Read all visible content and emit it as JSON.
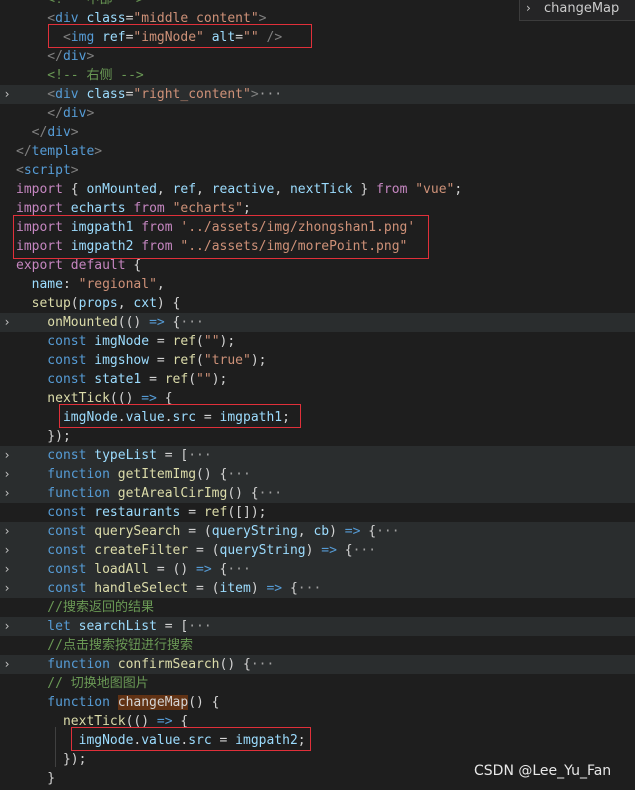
{
  "find_widget": {
    "query": "changeMap"
  },
  "lines": [
    {
      "fold": "",
      "segments": [
        [
          "t-cmt",
          "    <!-- 中部 -->"
        ]
      ]
    },
    {
      "fold": "",
      "segments": [
        [
          "t-tag",
          "    <"
        ],
        [
          "t-name",
          "div"
        ],
        [
          "t-pl",
          " "
        ],
        [
          "t-attr",
          "class"
        ],
        [
          "t-pl",
          "="
        ],
        [
          "t-str",
          "\"middle content\""
        ],
        [
          "t-tag",
          ">"
        ]
      ]
    },
    {
      "fold": "",
      "segments": [
        [
          "t-tag",
          "      <"
        ],
        [
          "t-name",
          "img"
        ],
        [
          "t-pl",
          " "
        ],
        [
          "t-attr",
          "ref"
        ],
        [
          "t-pl",
          "="
        ],
        [
          "t-str",
          "\"imgNode\""
        ],
        [
          "t-pl",
          " "
        ],
        [
          "t-attr",
          "alt"
        ],
        [
          "t-pl",
          "="
        ],
        [
          "t-str",
          "\"\""
        ],
        [
          "t-pl",
          " "
        ],
        [
          "t-tag",
          "/>"
        ]
      ]
    },
    {
      "fold": "",
      "segments": [
        [
          "t-tag",
          "    </"
        ],
        [
          "t-name",
          "div"
        ],
        [
          "t-tag",
          ">"
        ]
      ]
    },
    {
      "fold": "",
      "segments": [
        [
          "t-cmt",
          "    <!-- 右侧 -->"
        ]
      ]
    },
    {
      "fold": "›",
      "segments": [
        [
          "t-tag",
          "    <"
        ],
        [
          "t-name",
          "div"
        ],
        [
          "t-pl",
          " "
        ],
        [
          "t-attr",
          "class"
        ],
        [
          "t-pl",
          "="
        ],
        [
          "t-str",
          "\"right_content\""
        ],
        [
          "t-tag",
          ">"
        ],
        [
          "t-ell",
          "···"
        ]
      ]
    },
    {
      "fold": "",
      "segments": [
        [
          "t-tag",
          "    </"
        ],
        [
          "t-name",
          "div"
        ],
        [
          "t-tag",
          ">"
        ]
      ]
    },
    {
      "fold": "",
      "segments": [
        [
          "t-tag",
          "  </"
        ],
        [
          "t-name",
          "div"
        ],
        [
          "t-tag",
          ">"
        ]
      ]
    },
    {
      "fold": "",
      "segments": [
        [
          "t-tag",
          "</"
        ],
        [
          "t-name",
          "template"
        ],
        [
          "t-tag",
          ">"
        ]
      ]
    },
    {
      "fold": "",
      "segments": [
        [
          "t-tag",
          "<"
        ],
        [
          "t-name",
          "script"
        ],
        [
          "t-tag",
          ">"
        ]
      ]
    },
    {
      "fold": "",
      "segments": [
        [
          "t-kw",
          "import"
        ],
        [
          "t-pl",
          " { "
        ],
        [
          "t-var",
          "onMounted"
        ],
        [
          "t-pl",
          ", "
        ],
        [
          "t-var",
          "ref"
        ],
        [
          "t-pl",
          ", "
        ],
        [
          "t-var",
          "reactive"
        ],
        [
          "t-pl",
          ", "
        ],
        [
          "t-var",
          "nextTick"
        ],
        [
          "t-pl",
          " } "
        ],
        [
          "t-kw",
          "from"
        ],
        [
          "t-pl",
          " "
        ],
        [
          "t-str",
          "\"vue\""
        ],
        [
          "t-pl",
          ";"
        ]
      ]
    },
    {
      "fold": "",
      "segments": [
        [
          "t-kw",
          "import"
        ],
        [
          "t-pl",
          " "
        ],
        [
          "t-var",
          "echarts"
        ],
        [
          "t-pl",
          " "
        ],
        [
          "t-kw",
          "from"
        ],
        [
          "t-pl",
          " "
        ],
        [
          "t-str",
          "\"echarts\""
        ],
        [
          "t-pl",
          ";"
        ]
      ]
    },
    {
      "fold": "",
      "segments": [
        [
          "t-kw",
          "import"
        ],
        [
          "t-pl",
          " "
        ],
        [
          "t-var",
          "imgpath1"
        ],
        [
          "t-pl",
          " "
        ],
        [
          "t-kw",
          "from"
        ],
        [
          "t-pl",
          " "
        ],
        [
          "t-str",
          "'../assets/img/zhongshan1.png'"
        ]
      ]
    },
    {
      "fold": "",
      "segments": [
        [
          "t-kw",
          "import"
        ],
        [
          "t-pl",
          " "
        ],
        [
          "t-var",
          "imgpath2"
        ],
        [
          "t-pl",
          " "
        ],
        [
          "t-kw",
          "from"
        ],
        [
          "t-pl",
          " "
        ],
        [
          "t-str",
          "\"../assets/img/morePoint.png\""
        ]
      ]
    },
    {
      "fold": "",
      "segments": [
        [
          "t-kw",
          "export"
        ],
        [
          "t-pl",
          " "
        ],
        [
          "t-kw",
          "default"
        ],
        [
          "t-pl",
          " {"
        ]
      ]
    },
    {
      "fold": "",
      "segments": [
        [
          "t-var",
          "  name"
        ],
        [
          "t-pl",
          ": "
        ],
        [
          "t-str",
          "\"regional\""
        ],
        [
          "t-pl",
          ","
        ]
      ]
    },
    {
      "fold": "",
      "segments": [
        [
          "t-fn",
          "  setup"
        ],
        [
          "t-pl",
          "("
        ],
        [
          "t-var",
          "props"
        ],
        [
          "t-pl",
          ", "
        ],
        [
          "t-var",
          "cxt"
        ],
        [
          "t-pl",
          ") {"
        ]
      ]
    },
    {
      "fold": "›",
      "segments": [
        [
          "t-fn",
          "    onMounted"
        ],
        [
          "t-pl",
          "(() "
        ],
        [
          "t-st",
          "=>"
        ],
        [
          "t-pl",
          " {"
        ],
        [
          "t-ell",
          "···"
        ]
      ]
    },
    {
      "fold": "",
      "segments": [
        [
          "t-st",
          "    const"
        ],
        [
          "t-pl",
          " "
        ],
        [
          "t-var",
          "imgNode"
        ],
        [
          "t-pl",
          " = "
        ],
        [
          "t-fn",
          "ref"
        ],
        [
          "t-pl",
          "("
        ],
        [
          "t-str",
          "\"\""
        ],
        [
          "t-pl",
          ");"
        ]
      ]
    },
    {
      "fold": "",
      "segments": [
        [
          "t-st",
          "    const"
        ],
        [
          "t-pl",
          " "
        ],
        [
          "t-var",
          "imgshow"
        ],
        [
          "t-pl",
          " = "
        ],
        [
          "t-fn",
          "ref"
        ],
        [
          "t-pl",
          "("
        ],
        [
          "t-str",
          "\"true\""
        ],
        [
          "t-pl",
          ");"
        ]
      ]
    },
    {
      "fold": "",
      "segments": [
        [
          "t-st",
          "    const"
        ],
        [
          "t-pl",
          " "
        ],
        [
          "t-var",
          "state1"
        ],
        [
          "t-pl",
          " = "
        ],
        [
          "t-fn",
          "ref"
        ],
        [
          "t-pl",
          "("
        ],
        [
          "t-str",
          "\"\""
        ],
        [
          "t-pl",
          ");"
        ]
      ]
    },
    {
      "fold": "",
      "segments": [
        [
          "t-fn",
          "    nextTick"
        ],
        [
          "t-pl",
          "(() "
        ],
        [
          "t-st",
          "=>"
        ],
        [
          "t-pl",
          " {"
        ]
      ]
    },
    {
      "fold": "",
      "segments": [
        [
          "t-var",
          "      imgNode"
        ],
        [
          "t-pl",
          "."
        ],
        [
          "t-var",
          "value"
        ],
        [
          "t-pl",
          "."
        ],
        [
          "t-var",
          "src"
        ],
        [
          "t-pl",
          " = "
        ],
        [
          "t-var",
          "imgpath1"
        ],
        [
          "t-pl",
          ";"
        ]
      ]
    },
    {
      "fold": "",
      "segments": [
        [
          "t-pl",
          "    });"
        ]
      ]
    },
    {
      "fold": "›",
      "segments": [
        [
          "t-st",
          "    const"
        ],
        [
          "t-pl",
          " "
        ],
        [
          "t-var",
          "typeList"
        ],
        [
          "t-pl",
          " = ["
        ],
        [
          "t-ell",
          "···"
        ]
      ]
    },
    {
      "fold": "›",
      "segments": [
        [
          "t-st",
          "    function"
        ],
        [
          "t-pl",
          " "
        ],
        [
          "t-fn",
          "getItemImg"
        ],
        [
          "t-pl",
          "() {"
        ],
        [
          "t-ell",
          "···"
        ]
      ]
    },
    {
      "fold": "›",
      "segments": [
        [
          "t-st",
          "    function"
        ],
        [
          "t-pl",
          " "
        ],
        [
          "t-fn",
          "getArealCirImg"
        ],
        [
          "t-pl",
          "() {"
        ],
        [
          "t-ell",
          "···"
        ]
      ]
    },
    {
      "fold": "",
      "segments": [
        [
          "t-st",
          "    const"
        ],
        [
          "t-pl",
          " "
        ],
        [
          "t-var",
          "restaurants"
        ],
        [
          "t-pl",
          " = "
        ],
        [
          "t-fn",
          "ref"
        ],
        [
          "t-pl",
          "([]);"
        ]
      ]
    },
    {
      "fold": "›",
      "segments": [
        [
          "t-st",
          "    const"
        ],
        [
          "t-pl",
          " "
        ],
        [
          "t-fn",
          "querySearch"
        ],
        [
          "t-pl",
          " = ("
        ],
        [
          "t-var",
          "queryString"
        ],
        [
          "t-pl",
          ", "
        ],
        [
          "t-var",
          "cb"
        ],
        [
          "t-pl",
          ") "
        ],
        [
          "t-st",
          "=>"
        ],
        [
          "t-pl",
          " {"
        ],
        [
          "t-ell",
          "···"
        ]
      ]
    },
    {
      "fold": "›",
      "segments": [
        [
          "t-st",
          "    const"
        ],
        [
          "t-pl",
          " "
        ],
        [
          "t-fn",
          "createFilter"
        ],
        [
          "t-pl",
          " = ("
        ],
        [
          "t-var",
          "queryString"
        ],
        [
          "t-pl",
          ") "
        ],
        [
          "t-st",
          "=>"
        ],
        [
          "t-pl",
          " {"
        ],
        [
          "t-ell",
          "···"
        ]
      ]
    },
    {
      "fold": "›",
      "segments": [
        [
          "t-st",
          "    const"
        ],
        [
          "t-pl",
          " "
        ],
        [
          "t-fn",
          "loadAll"
        ],
        [
          "t-pl",
          " = () "
        ],
        [
          "t-st",
          "=>"
        ],
        [
          "t-pl",
          " {"
        ],
        [
          "t-ell",
          "···"
        ]
      ]
    },
    {
      "fold": "›",
      "segments": [
        [
          "t-st",
          "    const"
        ],
        [
          "t-pl",
          " "
        ],
        [
          "t-fn",
          "handleSelect"
        ],
        [
          "t-pl",
          " = ("
        ],
        [
          "t-var",
          "item"
        ],
        [
          "t-pl",
          ") "
        ],
        [
          "t-st",
          "=>"
        ],
        [
          "t-pl",
          " {"
        ],
        [
          "t-ell",
          "···"
        ]
      ]
    },
    {
      "fold": "",
      "segments": [
        [
          "t-cmt",
          "    //搜索返回的结果"
        ]
      ]
    },
    {
      "fold": "›",
      "segments": [
        [
          "t-st",
          "    let"
        ],
        [
          "t-pl",
          " "
        ],
        [
          "t-var",
          "searchList"
        ],
        [
          "t-pl",
          " = ["
        ],
        [
          "t-ell",
          "···"
        ]
      ]
    },
    {
      "fold": "",
      "segments": [
        [
          "t-cmt",
          "    //点击搜索按钮进行搜索"
        ]
      ]
    },
    {
      "fold": "›",
      "segments": [
        [
          "t-st",
          "    function"
        ],
        [
          "t-pl",
          " "
        ],
        [
          "t-fn",
          "confirmSearch"
        ],
        [
          "t-pl",
          "() {"
        ],
        [
          "t-ell",
          "···"
        ]
      ]
    },
    {
      "fold": "",
      "segments": [
        [
          "t-cmt",
          "    // 切换地图图片"
        ]
      ]
    },
    {
      "fold": "",
      "segments": [
        [
          "t-st",
          "    function"
        ],
        [
          "t-pl",
          " "
        ],
        [
          "t-hl",
          "changeMap"
        ],
        [
          "t-pl",
          "() {"
        ]
      ]
    },
    {
      "fold": "",
      "segments": [
        [
          "t-fn",
          "      nextTick"
        ],
        [
          "t-pl",
          "(() "
        ],
        [
          "t-st",
          "=>"
        ],
        [
          "t-pl",
          " {"
        ]
      ]
    },
    {
      "fold": "",
      "segments": [
        [
          "t-var",
          "        imgNode"
        ],
        [
          "t-pl",
          "."
        ],
        [
          "t-var",
          "value"
        ],
        [
          "t-pl",
          "."
        ],
        [
          "t-var",
          "src"
        ],
        [
          "t-pl",
          " = "
        ],
        [
          "t-var",
          "imgpath2"
        ],
        [
          "t-pl",
          ";"
        ]
      ]
    },
    {
      "fold": "",
      "segments": [
        [
          "t-pl",
          "      });"
        ]
      ]
    },
    {
      "fold": "",
      "segments": [
        [
          "t-pl",
          "    }"
        ]
      ]
    }
  ],
  "watermark": "CSDN @Lee_Yu_Fan",
  "colors": {
    "background": "#1e1e1e",
    "highlight_box": "#e0303a",
    "folded_line": "#2a2d2e"
  }
}
